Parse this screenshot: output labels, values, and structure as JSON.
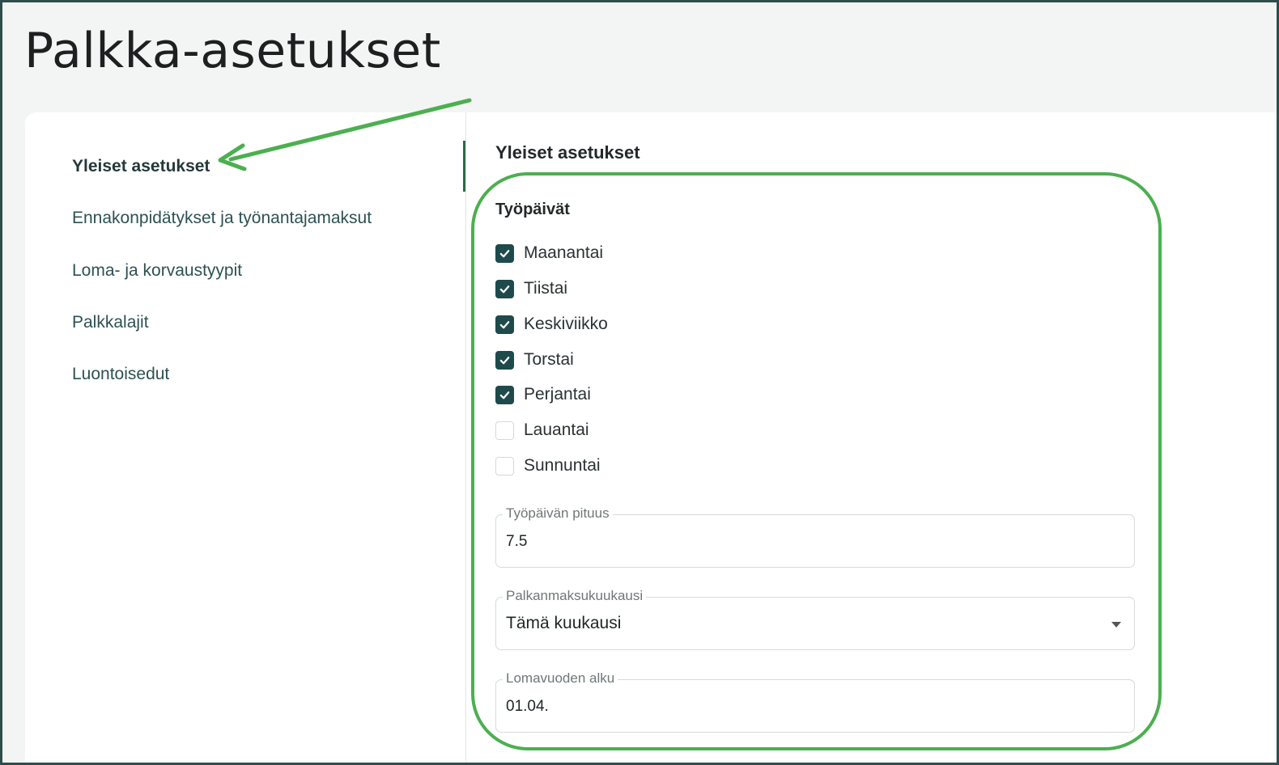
{
  "page": {
    "title": "Palkka-asetukset"
  },
  "sidebar": {
    "items": [
      {
        "label": "Yleiset asetukset",
        "active": true
      },
      {
        "label": "Ennakonpidätykset ja työnantajamaksut",
        "active": false
      },
      {
        "label": "Loma- ja korvaustyypit",
        "active": false
      },
      {
        "label": "Palkkalajit",
        "active": false
      },
      {
        "label": "Luontoisedut",
        "active": false
      }
    ]
  },
  "main": {
    "section_title": "Yleiset asetukset",
    "workdays": {
      "title": "Työpäivät",
      "days": [
        {
          "label": "Maanantai",
          "checked": true
        },
        {
          "label": "Tiistai",
          "checked": true
        },
        {
          "label": "Keskiviikko",
          "checked": true
        },
        {
          "label": "Torstai",
          "checked": true
        },
        {
          "label": "Perjantai",
          "checked": true
        },
        {
          "label": "Lauantai",
          "checked": false
        },
        {
          "label": "Sunnuntai",
          "checked": false
        }
      ]
    },
    "workday_length": {
      "label": "Työpäivän pituus",
      "value": "7.5"
    },
    "payment_month": {
      "label": "Palkanmaksukuukausi",
      "value": "Tämä kuukausi"
    },
    "holiday_year_start": {
      "label": "Lomavuoden alku",
      "value": "01.04."
    }
  },
  "colors": {
    "accent": "#2a6b46",
    "checkbox": "#1f4a4c",
    "annotation": "#4caf50",
    "frame": "#2e4e4c"
  },
  "icons": {
    "checkmark": "check-icon",
    "dropdown": "chevron-down-icon"
  }
}
